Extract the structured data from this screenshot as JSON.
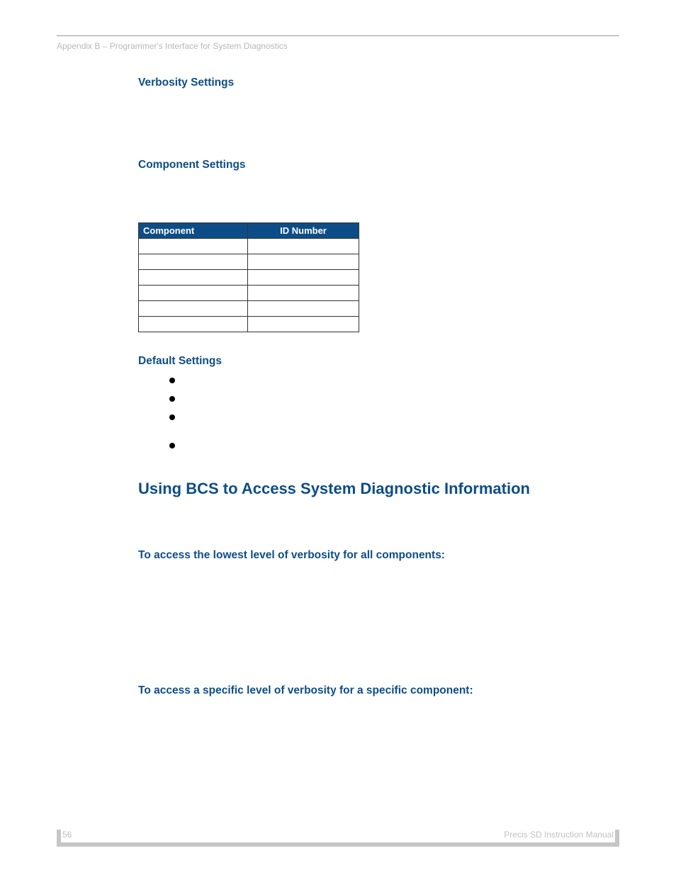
{
  "running_header": "Appendix B – Programmer's Interface for System Diagnostics",
  "headings": {
    "verbosity": "Verbosity Settings",
    "component_settings": "Component Settings",
    "default_settings": "Default Settings",
    "using_bcs": "Using BCS to Access System Diagnostic Information",
    "access_lowest": "To access the lowest level of verbosity for all components:",
    "access_specific": "To access a specific level of verbosity for a specific component:"
  },
  "table": {
    "header_component": "Component",
    "header_id": "ID Number",
    "rows": [
      {
        "component": "",
        "id": ""
      },
      {
        "component": "",
        "id": ""
      },
      {
        "component": "",
        "id": ""
      },
      {
        "component": "",
        "id": ""
      },
      {
        "component": "",
        "id": ""
      },
      {
        "component": "",
        "id": ""
      }
    ]
  },
  "defaults_bullets": [
    "",
    "",
    "",
    ""
  ],
  "footer": {
    "page_number": "56",
    "manual": "Precis SD Instruction Manual"
  }
}
